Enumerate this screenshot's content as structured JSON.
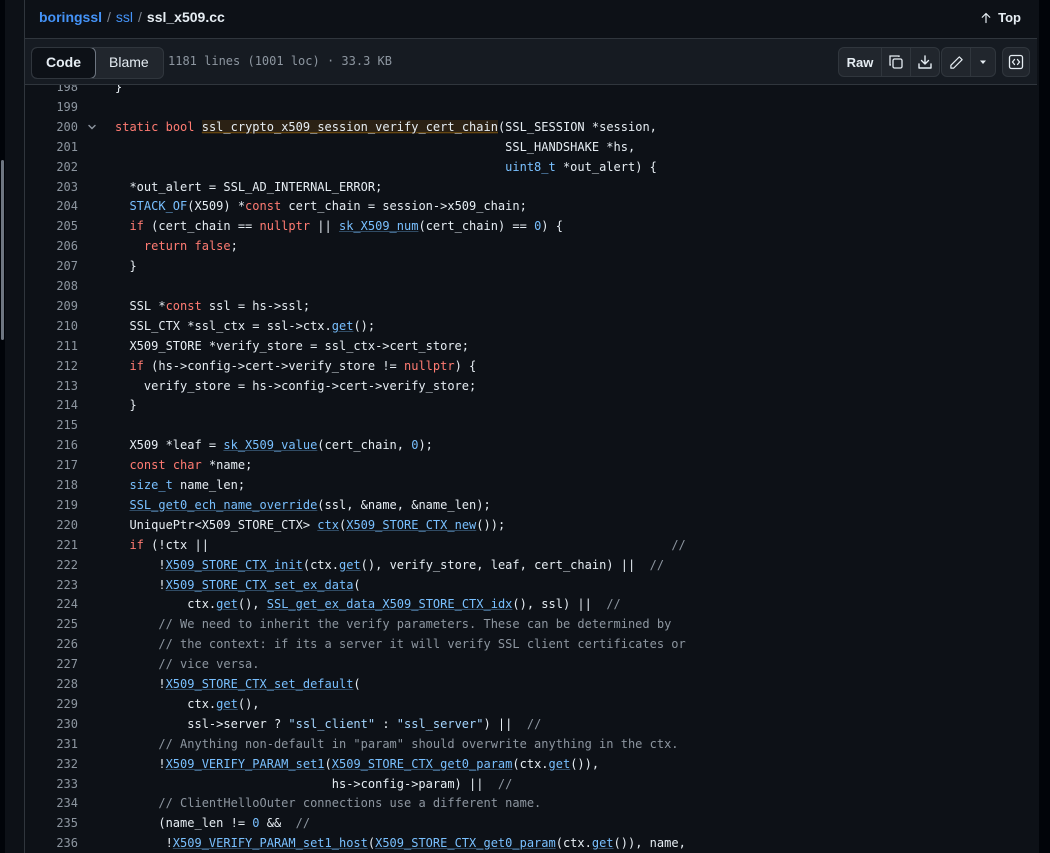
{
  "breadcrumb": {
    "repo": "boringssl",
    "dir": "ssl",
    "file": "ssl_x509.cc",
    "sep": "/"
  },
  "top_link": "Top",
  "toolbar": {
    "tab_code": "Code",
    "tab_blame": "Blame",
    "file_info": "1181 lines (1001 loc) · 33.3 KB",
    "raw_label": "Raw"
  },
  "code": {
    "lines": [
      {
        "n": "198",
        "t": "}"
      },
      {
        "n": "199",
        "t": ""
      },
      {
        "n": "200",
        "t": "static bool ssl_crypto_x509_session_verify_cert_chain(SSL_SESSION *session,",
        "fold": true
      },
      {
        "n": "201",
        "t": "                                                      SSL_HANDSHAKE *hs,"
      },
      {
        "n": "202",
        "t": "                                                      uint8_t *out_alert) {"
      },
      {
        "n": "203",
        "t": "  *out_alert = SSL_AD_INTERNAL_ERROR;"
      },
      {
        "n": "204",
        "t": "  STACK_OF(X509) *const cert_chain = session->x509_chain;"
      },
      {
        "n": "205",
        "t": "  if (cert_chain == nullptr || sk_X509_num(cert_chain) == 0) {"
      },
      {
        "n": "206",
        "t": "    return false;"
      },
      {
        "n": "207",
        "t": "  }"
      },
      {
        "n": "208",
        "t": ""
      },
      {
        "n": "209",
        "t": "  SSL *const ssl = hs->ssl;"
      },
      {
        "n": "210",
        "t": "  SSL_CTX *ssl_ctx = ssl->ctx.get();"
      },
      {
        "n": "211",
        "t": "  X509_STORE *verify_store = ssl_ctx->cert_store;"
      },
      {
        "n": "212",
        "t": "  if (hs->config->cert->verify_store != nullptr) {"
      },
      {
        "n": "213",
        "t": "    verify_store = hs->config->cert->verify_store;"
      },
      {
        "n": "214",
        "t": "  }"
      },
      {
        "n": "215",
        "t": ""
      },
      {
        "n": "216",
        "t": "  X509 *leaf = sk_X509_value(cert_chain, 0);"
      },
      {
        "n": "217",
        "t": "  const char *name;"
      },
      {
        "n": "218",
        "t": "  size_t name_len;"
      },
      {
        "n": "219",
        "t": "  SSL_get0_ech_name_override(ssl, &name, &name_len);"
      },
      {
        "n": "220",
        "t": "  UniquePtr<X509_STORE_CTX> ctx(X509_STORE_CTX_new());"
      },
      {
        "n": "221",
        "t": "  if (!ctx ||                                                                //"
      },
      {
        "n": "222",
        "t": "      !X509_STORE_CTX_init(ctx.get(), verify_store, leaf, cert_chain) ||  //"
      },
      {
        "n": "223",
        "t": "      !X509_STORE_CTX_set_ex_data("
      },
      {
        "n": "224",
        "t": "          ctx.get(), SSL_get_ex_data_X509_STORE_CTX_idx(), ssl) ||  //"
      },
      {
        "n": "225",
        "t": "      // We need to inherit the verify parameters. These can be determined by"
      },
      {
        "n": "226",
        "t": "      // the context: if its a server it will verify SSL client certificates or"
      },
      {
        "n": "227",
        "t": "      // vice versa."
      },
      {
        "n": "228",
        "t": "      !X509_STORE_CTX_set_default("
      },
      {
        "n": "229",
        "t": "          ctx.get(),"
      },
      {
        "n": "230",
        "t": "          ssl->server ? \"ssl_client\" : \"ssl_server\") ||  //"
      },
      {
        "n": "231",
        "t": "      // Anything non-default in \"param\" should overwrite anything in the ctx."
      },
      {
        "n": "232",
        "t": "      !X509_VERIFY_PARAM_set1(X509_STORE_CTX_get0_param(ctx.get()),"
      },
      {
        "n": "233",
        "t": "                              hs->config->param) ||  //"
      },
      {
        "n": "234",
        "t": "      // ClientHelloOuter connections use a different name."
      },
      {
        "n": "235",
        "t": "      (name_len != 0 &&  //"
      },
      {
        "n": "236",
        "t": "       !X509_VERIFY_PARAM_set1_host(X509_STORE_CTX_get0_param(ctx.get()), name,"
      }
    ]
  }
}
